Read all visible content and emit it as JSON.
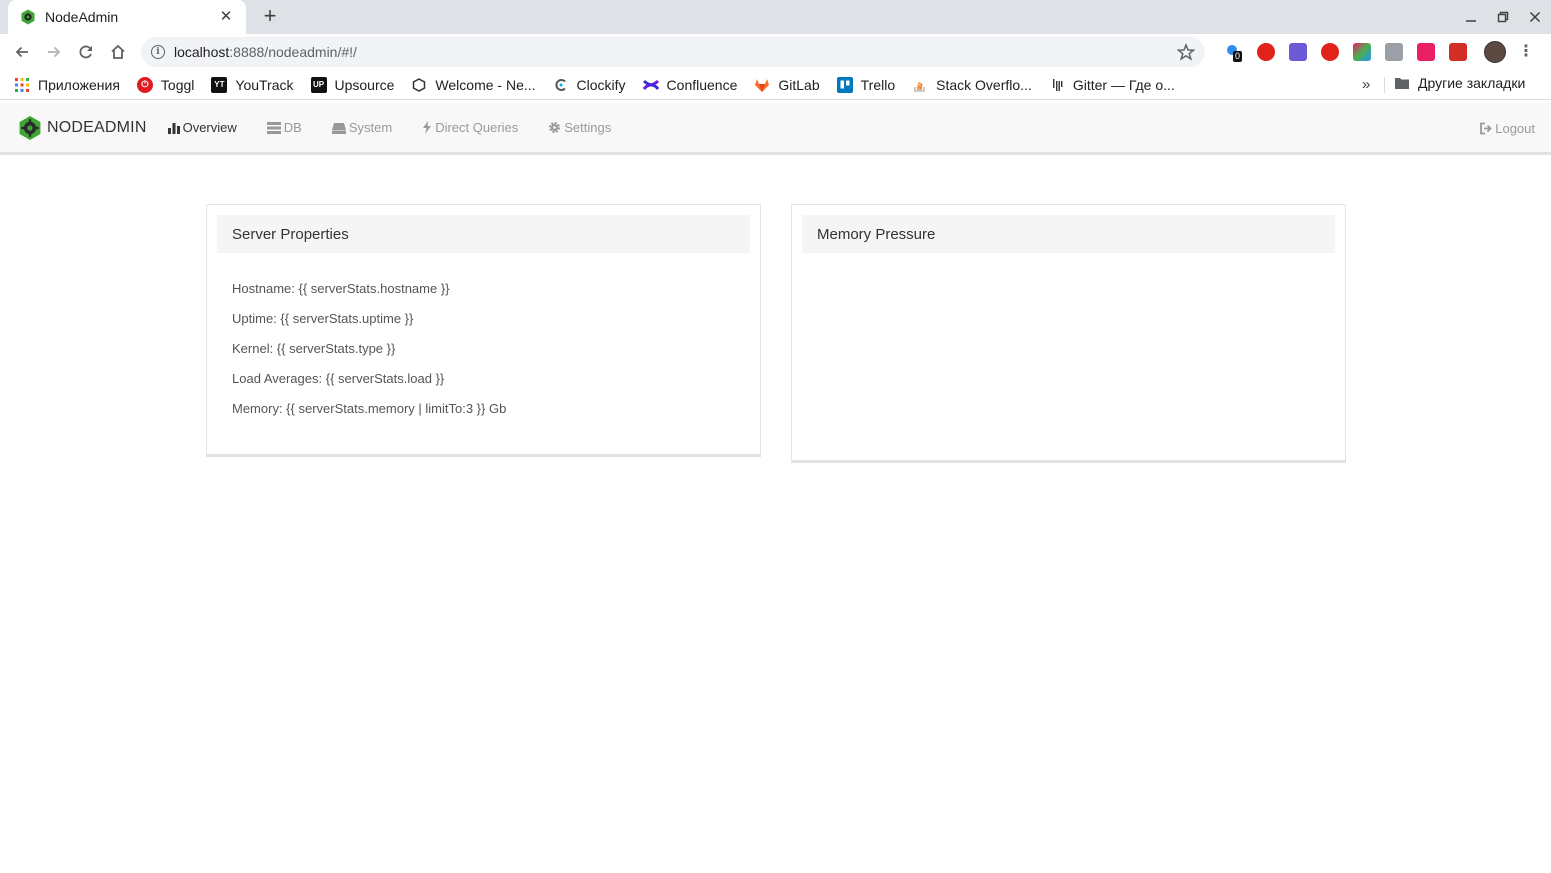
{
  "browser": {
    "tab_title": "NodeAdmin",
    "url_host": "localhost",
    "url_rest": ":8888/nodeadmin/#!/",
    "bookmarks": [
      {
        "label": "Приложения",
        "icon": "apps-grid-icon",
        "color": "#ea4335"
      },
      {
        "label": "Toggl",
        "icon": "toggl-icon",
        "color": "#e01b22"
      },
      {
        "label": "YouTrack",
        "icon": "youtrack-icon",
        "color": "#111111"
      },
      {
        "label": "Upsource",
        "icon": "upsource-icon",
        "color": "#111111"
      },
      {
        "label": "Welcome - Ne...",
        "icon": "hexagon-icon",
        "color": "#333333"
      },
      {
        "label": "Clockify",
        "icon": "clockify-icon",
        "color": "#03a9f4"
      },
      {
        "label": "Confluence",
        "icon": "confluence-icon",
        "color": "#6a1bde"
      },
      {
        "label": "GitLab",
        "icon": "gitlab-icon",
        "color": "#fc6d26"
      },
      {
        "label": "Trello",
        "icon": "trello-icon",
        "color": "#0079bf"
      },
      {
        "label": "Stack Overflo...",
        "icon": "stackoverflow-icon",
        "color": "#f48024"
      },
      {
        "label": "Gitter — Где о...",
        "icon": "gitter-icon",
        "color": "#333333"
      }
    ],
    "more_bookmarks": "»",
    "other_bookmarks": "Другие закладки",
    "ext_badge": "0"
  },
  "app": {
    "brand": "NODEADMIN",
    "menu": [
      {
        "label": "Overview",
        "icon": "bar-chart-icon",
        "active": true
      },
      {
        "label": "DB",
        "icon": "database-icon",
        "active": false
      },
      {
        "label": "System",
        "icon": "hdd-icon",
        "active": false
      },
      {
        "label": "Direct Queries",
        "icon": "flash-icon",
        "active": false
      },
      {
        "label": "Settings",
        "icon": "gear-icon",
        "active": false
      }
    ],
    "logout": "Logout"
  },
  "server_panel": {
    "title": "Server Properties",
    "props": [
      "Hostname: {{ serverStats.hostname }}",
      "Uptime: {{ serverStats.uptime }}",
      "Kernel: {{ serverStats.type }}",
      "Load Averages: {{ serverStats.load }}",
      "Memory: {{ serverStats.memory | limitTo:3 }} Gb"
    ]
  },
  "memory_panel": {
    "title": "Memory Pressure"
  },
  "colors": {
    "brand_green": "#3fa635",
    "brand_dark": "#2b2b2b"
  }
}
